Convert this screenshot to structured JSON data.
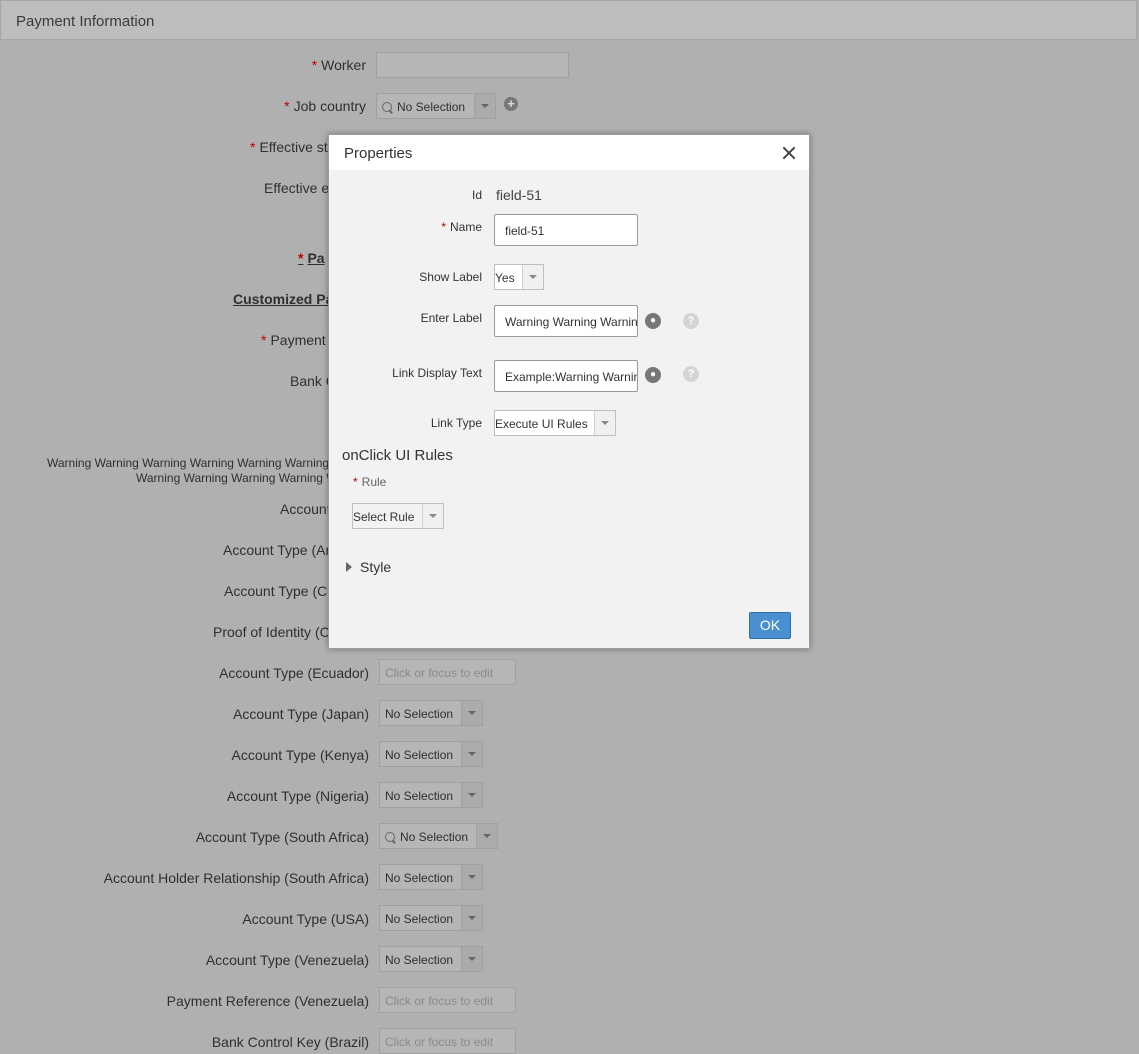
{
  "page": {
    "title": "Payment Information",
    "fields": {
      "worker": "Worker",
      "job_country": "Job country",
      "effective_start": "Effective sta",
      "effective_end": "Effective en",
      "pa": "Pa",
      "customized": "Customized Pa",
      "payment": "Payment I",
      "bank": "Bank C",
      "warning_1": "Warning Warning Warning Warning Warning Warning W",
      "warning_2": "Warning Warning Warning Warning W",
      "account": "Account",
      "acct_arg": "Account Type (Arg",
      "acct_co": "Account Type (Co",
      "proof": "Proof of Identity (Co",
      "acct_ecuador": "Account Type (Ecuador)",
      "acct_japan": "Account Type (Japan)",
      "acct_kenya": "Account Type (Kenya)",
      "acct_nigeria": "Account Type (Nigeria)",
      "acct_southafrica": "Account Type (South Africa)",
      "holder_rel": "Account Holder Relationship (South Africa)",
      "acct_usa": "Account Type (USA)",
      "acct_venezuela": "Account Type (Venezuela)",
      "pay_ref": "Payment Reference (Venezuela)",
      "bank_key": "Bank Control Key (Brazil)"
    },
    "no_selection": "No Selection",
    "click_placeholder": "Click or focus to edit",
    "required_mark": "*"
  },
  "modal": {
    "title": "Properties",
    "id_label": "Id",
    "id_value": "field-51",
    "name_label": "Name",
    "name_value": "field-51",
    "show_label_label": "Show Label",
    "show_label_value": "Yes",
    "enter_label_label": "Enter Label",
    "enter_label_value": "Warning Warning Warning Warning",
    "link_display_label": "Link Display Text",
    "link_display_value": "Example:Warning Warning",
    "link_type_label": "Link Type",
    "link_type_value": "Execute UI Rules",
    "onclick_title": "onClick UI Rules",
    "rule_label": "Rule",
    "rule_value": "Select Rule",
    "style_label": "Style",
    "ok_label": "OK",
    "help_glyph": "?",
    "globe_icon": "globe-icon"
  }
}
